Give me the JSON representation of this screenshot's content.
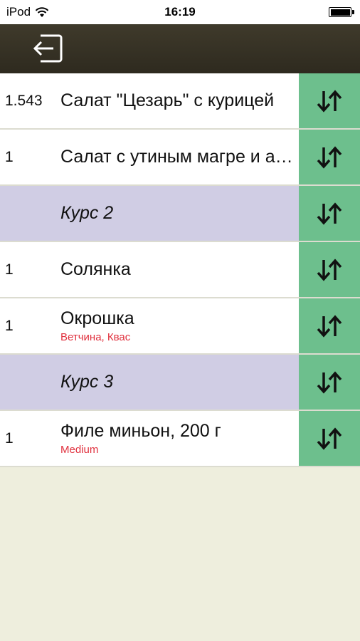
{
  "status": {
    "carrier": "iPod",
    "time": "16:19"
  },
  "nav": {
    "back_icon": "back-arrow-icon"
  },
  "rows": [
    {
      "type": "item",
      "qty": "1.543",
      "name": "Салат \"Цезарь\" с курицей",
      "mods": ""
    },
    {
      "type": "item",
      "qty": "1",
      "name": "Салат с утиным магре и апельсином",
      "mods": ""
    },
    {
      "type": "course",
      "qty": "",
      "name": "Курс 2",
      "mods": ""
    },
    {
      "type": "item",
      "qty": "1",
      "name": "Солянка",
      "mods": ""
    },
    {
      "type": "item",
      "qty": "1",
      "name": "Окрошка",
      "mods": "Ветчина, Квас"
    },
    {
      "type": "course",
      "qty": "",
      "name": "Курс 3",
      "mods": ""
    },
    {
      "type": "item",
      "qty": "1",
      "name": "Филе миньон, 200 г",
      "mods": "Medium"
    }
  ],
  "colors": {
    "nav_bg": "#3a3528",
    "move_button": "#6dbf8d",
    "course_bg": "#d0cde4",
    "modifier_text": "#e0303d",
    "page_bg": "#eeeedd"
  }
}
